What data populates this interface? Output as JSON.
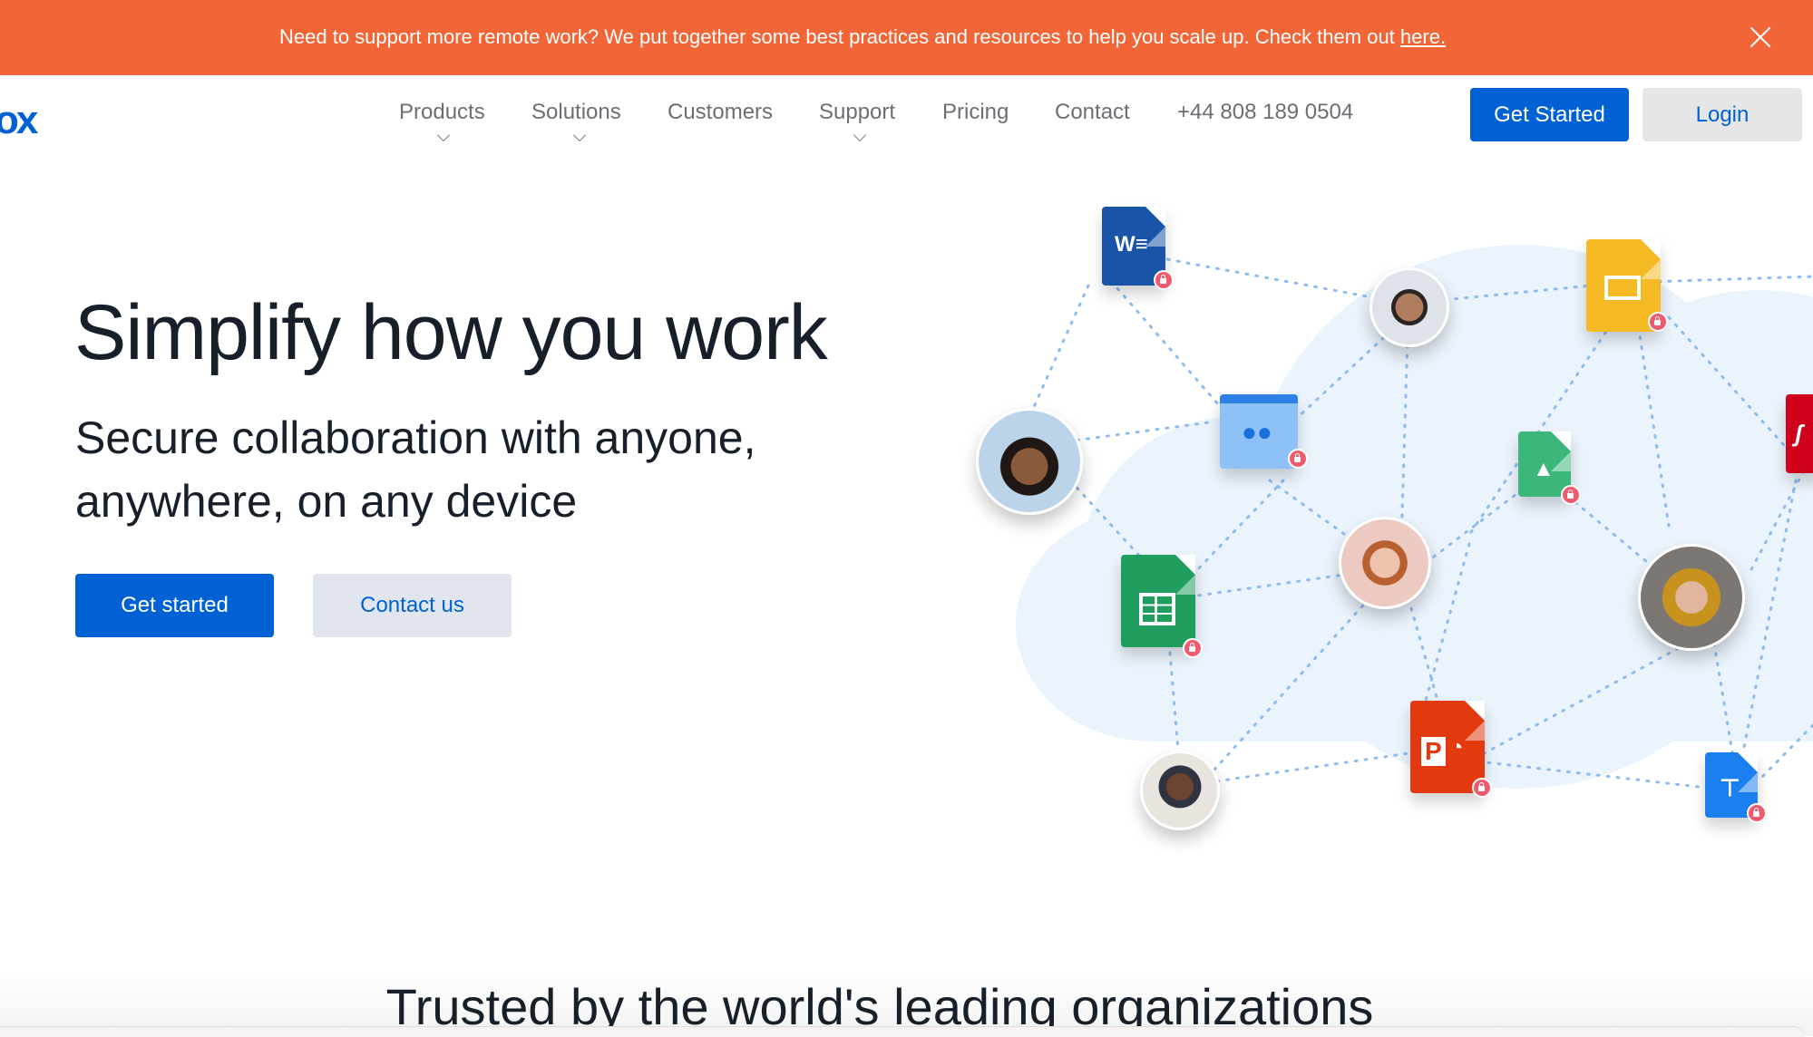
{
  "banner": {
    "message": "Need to support more remote work? We put together some best practices and resources to help you scale up. Check them out ",
    "link_text": "here.",
    "close_icon": "close-icon",
    "background": "#f26536"
  },
  "header": {
    "logo_text": "ox",
    "nav": [
      {
        "label": "Products",
        "has_dropdown": true
      },
      {
        "label": "Solutions",
        "has_dropdown": true
      },
      {
        "label": "Customers",
        "has_dropdown": false
      },
      {
        "label": "Support",
        "has_dropdown": true
      },
      {
        "label": "Pricing",
        "has_dropdown": false
      },
      {
        "label": "Contact",
        "has_dropdown": false
      },
      {
        "label": "+44 808 189 0504",
        "has_dropdown": false
      }
    ],
    "get_started_label": "Get Started",
    "login_label": "Login",
    "brand_color": "#0061d5"
  },
  "hero": {
    "title": "Simplify how you work",
    "subtitle": "Secure collaboration with anyone, anywhere, on any device",
    "primary_cta": "Get started",
    "secondary_cta": "Contact us"
  },
  "illustration": {
    "files": [
      {
        "type": "word-doc",
        "glyph": "W",
        "color": "#1a54a8"
      },
      {
        "type": "shared-folder",
        "glyph": "👥",
        "color": "#8ec1f7"
      },
      {
        "type": "slides-doc",
        "glyph": "",
        "color": "#f4b923"
      },
      {
        "type": "image-file",
        "glyph": "▲",
        "color": "#3db67b"
      },
      {
        "type": "pdf-file",
        "glyph": "ᔑ",
        "color": "#d0021b"
      },
      {
        "type": "sheets-doc",
        "glyph": "▦",
        "color": "#1f9e5e"
      },
      {
        "type": "powerpoint-doc",
        "glyph": "P",
        "color": "#e2390f"
      },
      {
        "type": "keynote-doc",
        "glyph": "⊤",
        "color": "#1b7ff0"
      }
    ],
    "people_count": 6,
    "lock_color": "#ef5a6f",
    "cloud_color": "#ebf3fc"
  },
  "trusted": {
    "heading": "Trusted by the world's leading organizations"
  }
}
